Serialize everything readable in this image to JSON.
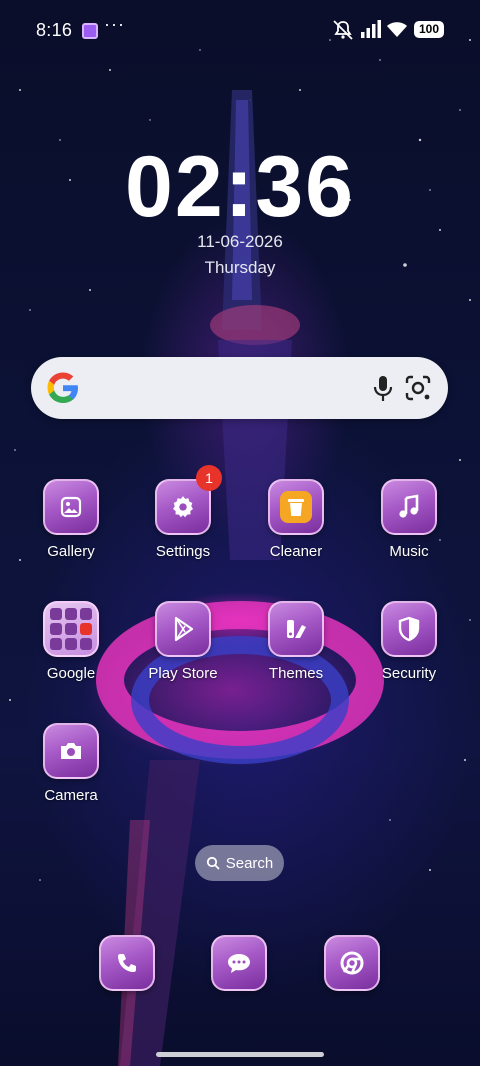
{
  "status_bar": {
    "time": "8:16",
    "more": "···",
    "battery": "100"
  },
  "lockscreen": {
    "clock": "02:36",
    "date": "11-06-2026",
    "weekday": "Thursday"
  },
  "search_widget": {
    "logo": "google-g-icon",
    "voice_icon": "mic-icon",
    "lens_icon": "lens-icon"
  },
  "apps": [
    {
      "label": "Gallery",
      "icon": "gallery-icon"
    },
    {
      "label": "Settings",
      "icon": "gear-icon",
      "badge": "1"
    },
    {
      "label": "Cleaner",
      "icon": "trash-icon"
    },
    {
      "label": "Music",
      "icon": "music-note-icon"
    },
    {
      "label": "Google",
      "icon": "folder-icon"
    },
    {
      "label": "Play Store",
      "icon": "play-icon"
    },
    {
      "label": "Themes",
      "icon": "themes-icon"
    },
    {
      "label": "Security",
      "icon": "shield-icon"
    },
    {
      "label": "Camera",
      "icon": "camera-icon"
    }
  ],
  "search_pill": {
    "label": "Search"
  },
  "dock": [
    {
      "icon": "phone-icon"
    },
    {
      "icon": "messages-icon"
    },
    {
      "icon": "chrome-icon"
    }
  ],
  "colors": {
    "tile_gradient_start": "#c98ae0",
    "tile_gradient_end": "#7a2f9e",
    "badge": "#e8332b",
    "cleaner_accent": "#f5a623"
  }
}
